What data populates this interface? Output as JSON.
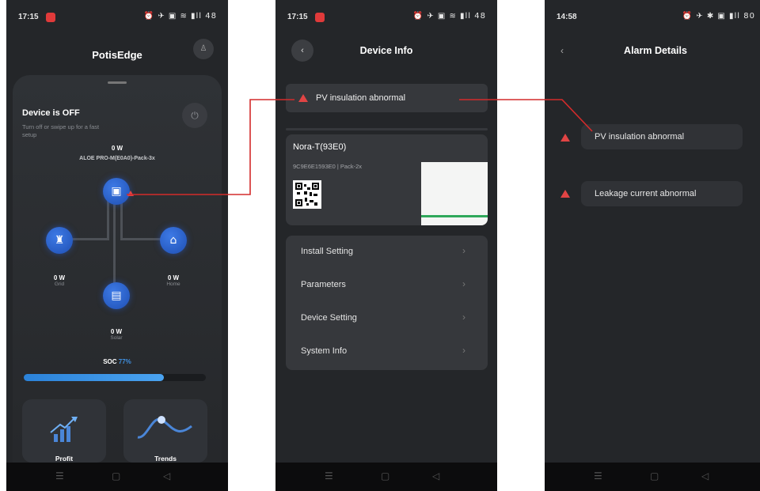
{
  "phone1": {
    "status": {
      "time": "17:15",
      "icons": "⏰ ✈ ▣ ≋ ▮ll 48"
    },
    "app_title": "PotisEdge",
    "device_state": "Device is OFF",
    "device_hint": "Turn off or swipe up for a fast setup",
    "device_power": "0 W",
    "device_model": "ALOE PRO-M(E0A0)-Pack-3x",
    "grid": {
      "value": "0 W",
      "label": "Grid"
    },
    "home": {
      "value": "0 W",
      "label": "Home"
    },
    "solar": {
      "value": "0 W",
      "label": "Solar"
    },
    "soc": {
      "label": "SOC",
      "value": "77%",
      "fraction": 0.77
    },
    "cards": {
      "profit": "Profit",
      "trends": "Trends"
    }
  },
  "phone2": {
    "status": {
      "time": "17:15",
      "icons": "⏰ ✈ ▣ ≋ ▮ll 48"
    },
    "title": "Device Info",
    "alarm": "PV insulation abnormal",
    "device": {
      "name": "Nora-T(93E0)",
      "serial": "9C9E6E1593E0 | Pack-2x"
    },
    "menu": [
      "Install Setting",
      "Parameters",
      "Device Setting",
      "System Info"
    ]
  },
  "phone3": {
    "status": {
      "time": "14:58",
      "icons": "⏰ ✈ ✱ ▣ ▮ll 80"
    },
    "title": "Alarm Details",
    "alarms": [
      "PV insulation abnormal",
      "Leakage current abnormal"
    ]
  },
  "colors": {
    "connector": "#d42b2b",
    "accent": "#3f8fe0",
    "alarm": "#e14444"
  }
}
